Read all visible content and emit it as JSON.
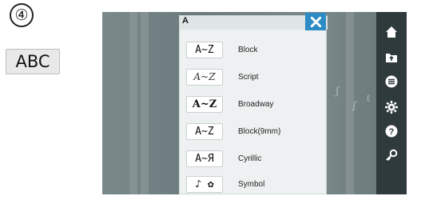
{
  "annotation": {
    "step_number": "④",
    "key_label": "ABC"
  },
  "font_menu": {
    "title": "A",
    "items": [
      {
        "sample": "A~Z",
        "label": "Block"
      },
      {
        "sample": "A~Z",
        "label": "Script"
      },
      {
        "sample": "A~Z",
        "label": "Broadway"
      },
      {
        "sample": "A~Z",
        "label": "Block(9mm)"
      },
      {
        "sample": "A~Я",
        "label": "Cyrillic"
      },
      {
        "sample": "♪ ✿",
        "label": "Symbol"
      }
    ]
  },
  "sidebar": {
    "icons": [
      "home-icon",
      "folder-icon",
      "menu-list-icon",
      "settings-gear-icon",
      "help-icon",
      "key-icon"
    ]
  },
  "colors": {
    "close_button": "#2d8cc6",
    "sidebar_bg": "#2f3a3c",
    "screen_bg": "#6b7b7d"
  }
}
